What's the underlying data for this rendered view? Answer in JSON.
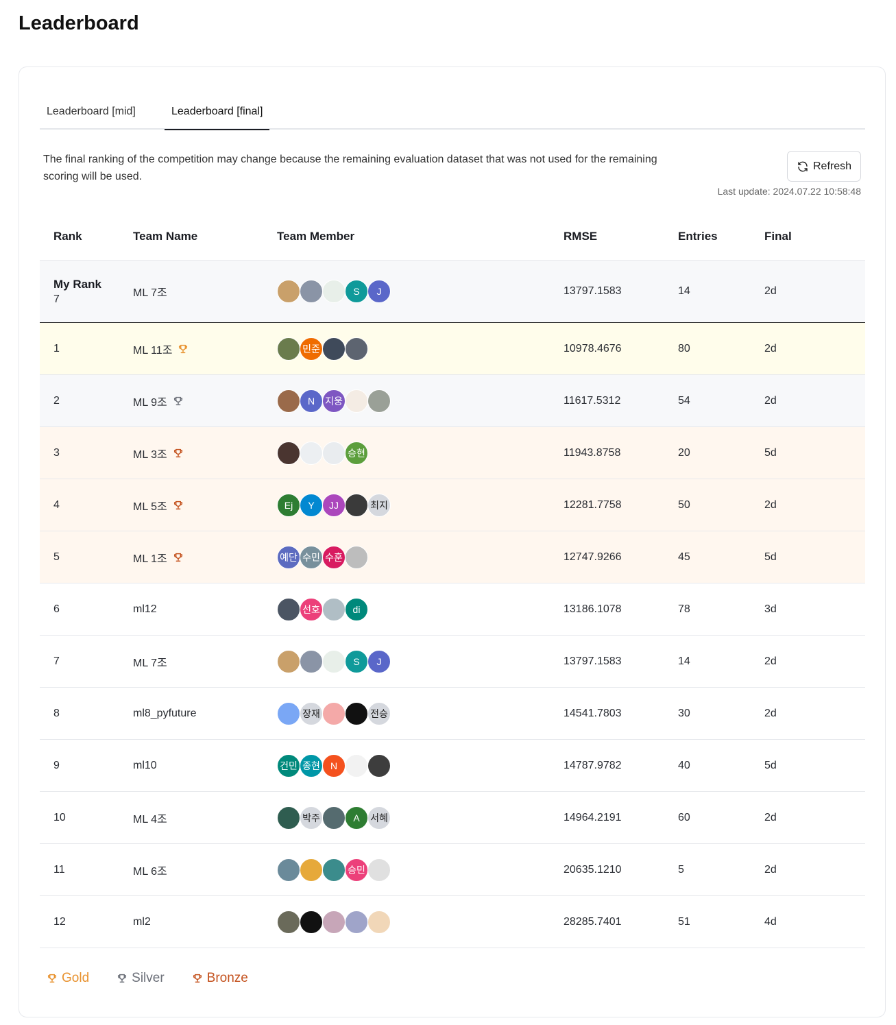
{
  "page": {
    "title": "Leaderboard"
  },
  "tabs": [
    {
      "label": "Leaderboard [mid]",
      "active": false
    },
    {
      "label": "Leaderboard [final]",
      "active": true
    }
  ],
  "notice": "The final ranking of the competition may change because the remaining evaluation dataset that was not used for the remaining scoring will be used.",
  "refresh": {
    "label": "Refresh"
  },
  "last_update": "Last update: 2024.07.22 10:58:48",
  "colors": {
    "gold": "#e8922f",
    "silver": "#6b6f78",
    "bronze": "#c4521e"
  },
  "columns": {
    "rank": "Rank",
    "team": "Team Name",
    "members": "Team Member",
    "rmse": "RMSE",
    "entries": "Entries",
    "final": "Final"
  },
  "my_rank": {
    "label": "My Rank",
    "rank": "7",
    "team": "ML 7조",
    "rmse": "13797.1583",
    "entries": "14",
    "final": "2d",
    "members": [
      {
        "text": "",
        "color": "#c9a06a"
      },
      {
        "text": "",
        "color": "#8a94a6"
      },
      {
        "text": "",
        "color": "#e8efe9"
      },
      {
        "text": "S",
        "color": "#0f9a9a"
      },
      {
        "text": "J",
        "color": "#5a67c9"
      }
    ]
  },
  "rows": [
    {
      "rank": "1",
      "team": "ML 11조",
      "medal": "gold",
      "rmse": "10978.4676",
      "entries": "80",
      "final": "2d",
      "members": [
        {
          "text": "",
          "color": "#6a7c4d"
        },
        {
          "text": "민준",
          "color": "#ef6c00"
        },
        {
          "text": "",
          "color": "#3f4a5a"
        },
        {
          "text": "",
          "color": "#5d6470"
        }
      ]
    },
    {
      "rank": "2",
      "team": "ML 9조",
      "medal": "silver",
      "rmse": "11617.5312",
      "entries": "54",
      "final": "2d",
      "members": [
        {
          "text": "",
          "color": "#9a6a4a"
        },
        {
          "text": "N",
          "color": "#5a67c9"
        },
        {
          "text": "지웅",
          "color": "#7e57c2"
        },
        {
          "text": "",
          "color": "#f4ece4"
        },
        {
          "text": "",
          "color": "#9aa097"
        }
      ]
    },
    {
      "rank": "3",
      "team": "ML 3조",
      "medal": "bronze",
      "rmse": "11943.8758",
      "entries": "20",
      "final": "5d",
      "members": [
        {
          "text": "",
          "color": "#4a3530"
        },
        {
          "text": "",
          "color": "#eceff2"
        },
        {
          "text": "",
          "color": "#e9ecef"
        },
        {
          "text": "승현",
          "color": "#5c9e3c"
        }
      ]
    },
    {
      "rank": "4",
      "team": "ML 5조",
      "medal": "bronze",
      "rmse": "12281.7758",
      "entries": "50",
      "final": "2d",
      "members": [
        {
          "text": "Ej",
          "color": "#2e7d32"
        },
        {
          "text": "Y",
          "color": "#0288d1"
        },
        {
          "text": "JJ",
          "color": "#ab47bc"
        },
        {
          "text": "",
          "color": "#3a3a3a"
        },
        {
          "text": "최지",
          "color": "#d5d8de",
          "light": true
        }
      ]
    },
    {
      "rank": "5",
      "team": "ML 1조",
      "medal": "bronze",
      "rmse": "12747.9266",
      "entries": "45",
      "final": "5d",
      "members": [
        {
          "text": "예단",
          "color": "#5c6bc0"
        },
        {
          "text": "수민",
          "color": "#78909c"
        },
        {
          "text": "수훈",
          "color": "#d81b60"
        },
        {
          "text": "",
          "color": "#bdbdbd"
        }
      ]
    },
    {
      "rank": "6",
      "team": "ml12",
      "medal": "",
      "rmse": "13186.1078",
      "entries": "78",
      "final": "3d",
      "members": [
        {
          "text": "",
          "color": "#4b5563"
        },
        {
          "text": "선호",
          "color": "#ec407a"
        },
        {
          "text": "",
          "color": "#b0bec5"
        },
        {
          "text": "di",
          "color": "#00897b"
        }
      ]
    },
    {
      "rank": "7",
      "team": "ML 7조",
      "medal": "",
      "rmse": "13797.1583",
      "entries": "14",
      "final": "2d",
      "members": [
        {
          "text": "",
          "color": "#c9a06a"
        },
        {
          "text": "",
          "color": "#8a94a6"
        },
        {
          "text": "",
          "color": "#e8efe9"
        },
        {
          "text": "S",
          "color": "#0f9a9a"
        },
        {
          "text": "J",
          "color": "#5a67c9"
        }
      ]
    },
    {
      "rank": "8",
      "team": "ml8_pyfuture",
      "medal": "",
      "rmse": "14541.7803",
      "entries": "30",
      "final": "2d",
      "members": [
        {
          "text": "",
          "color": "#7aa7f5"
        },
        {
          "text": "장재",
          "color": "#d5d8de",
          "light": true
        },
        {
          "text": "",
          "color": "#f4a9a8"
        },
        {
          "text": "",
          "color": "#111111"
        },
        {
          "text": "전승",
          "color": "#d5d8de",
          "light": true
        }
      ]
    },
    {
      "rank": "9",
      "team": "ml10",
      "medal": "",
      "rmse": "14787.9782",
      "entries": "40",
      "final": "5d",
      "members": [
        {
          "text": "건민",
          "color": "#00897b"
        },
        {
          "text": "종현",
          "color": "#0097a7"
        },
        {
          "text": "N",
          "color": "#f4511e"
        },
        {
          "text": "",
          "color": "#f2f2f2"
        },
        {
          "text": "",
          "color": "#3d3d3d"
        }
      ]
    },
    {
      "rank": "10",
      "team": "ML 4조",
      "medal": "",
      "rmse": "14964.2191",
      "entries": "60",
      "final": "2d",
      "members": [
        {
          "text": "",
          "color": "#2f5d50"
        },
        {
          "text": "박주",
          "color": "#d5d8de",
          "light": true
        },
        {
          "text": "",
          "color": "#556b6f"
        },
        {
          "text": "A",
          "color": "#2e7d32"
        },
        {
          "text": "서혜",
          "color": "#d5d8de",
          "light": true
        }
      ]
    },
    {
      "rank": "11",
      "team": "ML 6조",
      "medal": "",
      "rmse": "20635.1210",
      "entries": "5",
      "final": "2d",
      "members": [
        {
          "text": "",
          "color": "#6a8a9a"
        },
        {
          "text": "",
          "color": "#e6a93a"
        },
        {
          "text": "",
          "color": "#3b8c8c"
        },
        {
          "text": "승민",
          "color": "#ec407a"
        },
        {
          "text": "",
          "color": "#e0e0e0"
        }
      ]
    },
    {
      "rank": "12",
      "team": "ml2",
      "medal": "",
      "rmse": "28285.7401",
      "entries": "51",
      "final": "4d",
      "members": [
        {
          "text": "",
          "color": "#6a6a5a"
        },
        {
          "text": "",
          "color": "#111111"
        },
        {
          "text": "",
          "color": "#c7a6b8"
        },
        {
          "text": "",
          "color": "#9fa4c9"
        },
        {
          "text": "",
          "color": "#f1d7b8"
        }
      ]
    }
  ],
  "legend": [
    {
      "label": "Gold",
      "medal": "gold"
    },
    {
      "label": "Silver",
      "medal": "silver"
    },
    {
      "label": "Bronze",
      "medal": "bronze"
    }
  ]
}
